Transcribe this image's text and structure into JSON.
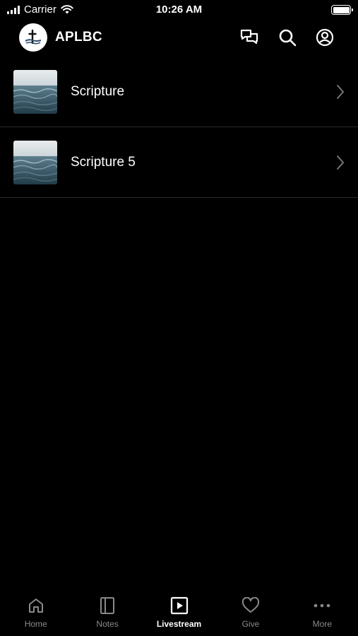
{
  "status_bar": {
    "carrier": "Carrier",
    "time": "10:26 AM"
  },
  "header": {
    "title": "APLBC",
    "icons": [
      "chat-icon",
      "search-icon",
      "profile-icon"
    ]
  },
  "items": [
    {
      "label": "Scripture"
    },
    {
      "label": "Scripture 5"
    }
  ],
  "tabs": [
    {
      "label": "Home",
      "icon": "home-icon",
      "active": false
    },
    {
      "label": "Notes",
      "icon": "notes-icon",
      "active": false
    },
    {
      "label": "Livestream",
      "icon": "play-icon",
      "active": true
    },
    {
      "label": "Give",
      "icon": "heart-icon",
      "active": false
    },
    {
      "label": "More",
      "icon": "more-icon",
      "active": false
    }
  ],
  "colors": {
    "background": "#000000",
    "text": "#ffffff",
    "tab_inactive": "#8a8a8a",
    "divider": "#2a2a2a"
  }
}
